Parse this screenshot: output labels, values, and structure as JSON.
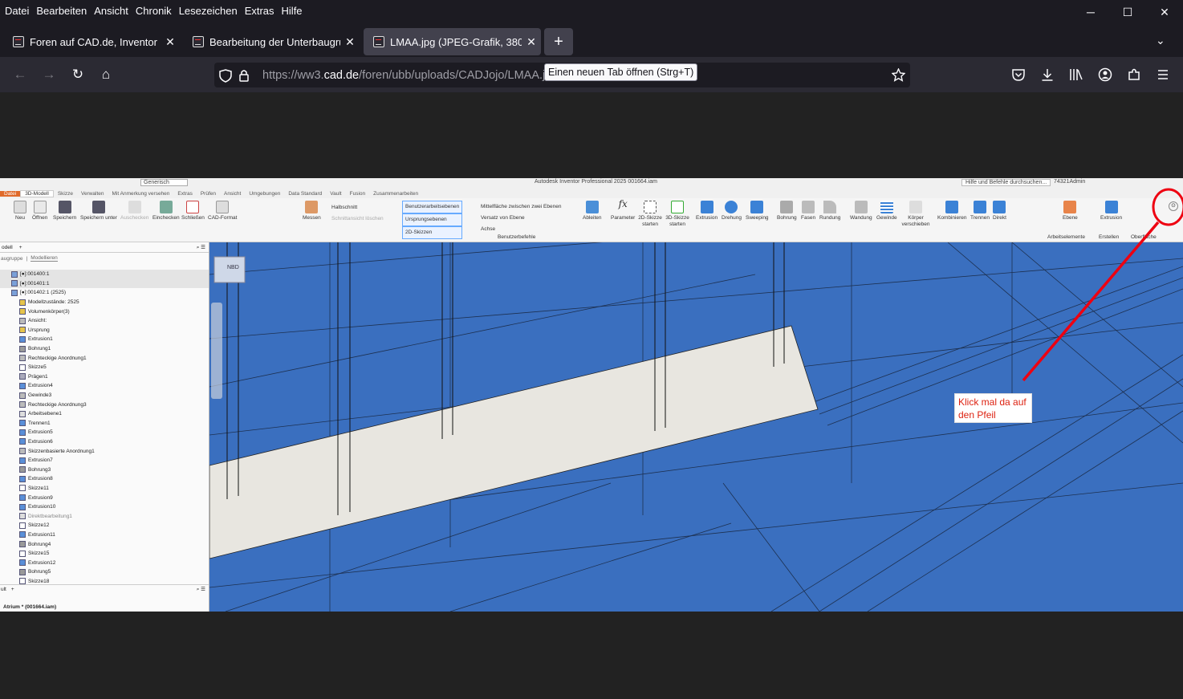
{
  "menu": [
    "Datei",
    "Bearbeiten",
    "Ansicht",
    "Chronik",
    "Lesezeichen",
    "Extras",
    "Hilfe"
  ],
  "window_controls": {
    "minimize": "─",
    "maximize": "☐",
    "close": "✕"
  },
  "tabs": [
    {
      "title": "Foren auf CAD.de, Inventor",
      "close": "✕"
    },
    {
      "title": "Bearbeitung der Unterbaugrupp",
      "close": "✕"
    },
    {
      "title": "LMAA.jpg (JPEG-Grafik, 3806",
      "close": "✕"
    }
  ],
  "new_tab_symbol": "+",
  "tab_list_symbol": "⌄",
  "nav": {
    "back": "←",
    "forward": "→",
    "reload": "↻",
    "home": "⌂"
  },
  "url": {
    "prefix": "https://ww3.",
    "domain": "cad.de",
    "path": "/foren/ubb/uploads/CADJojo/LMAA.jpg"
  },
  "tooltip": "Einen neuen Tab öffnen (Strg+T)",
  "inventor": {
    "title": "Autodesk Inventor Professional 2025    001664.iam",
    "search_hint": "Hilfe und Befehle durchsuchen...",
    "user": "74321Admin",
    "style_select": "Generisch",
    "ribbon_tabs": [
      "Datei",
      "3D-Modell",
      "Skizze",
      "Verwalten",
      "Mit Anmerkung versehen",
      "Extras",
      "Prüfen",
      "Ansicht",
      "Umgebungen",
      "Data Standard",
      "Vault",
      "Fusion",
      "Zusammenarbeiten"
    ],
    "ribbon_buttons": [
      "Neu",
      "Öffnen",
      "Speichern",
      "Speichern unter",
      "Auschecken",
      "Einchecken",
      "Schließen",
      "CAD-Format",
      "Messen",
      "Ableiten",
      "Parameter",
      "2D-Skizze starten",
      "3D-Skizze starten",
      "Extrusion",
      "Drehung",
      "Sweeping",
      "Bohrung",
      "Fasen",
      "Rundung",
      "Wandung",
      "Gewinde",
      "Körper verschieben",
      "Kombinieren",
      "Trennen",
      "Direkt",
      "Ebene",
      "Extrusion"
    ],
    "ribbon_small": [
      "Halbschnitt",
      "Schnittansicht löschen",
      "Benutzerarbeitsebenen",
      "Ursprungsebenen",
      "2D-Skizzen",
      "Mittelfläche zwischen zwei Ebenen",
      "Versatz von Ebene",
      "Achse"
    ],
    "ribbon_groups": [
      "Benutzerbefehle",
      "Arbeitselemente",
      "Erstellen",
      "Oberfläche"
    ],
    "browser_tabs": [
      "odell",
      "+"
    ],
    "browser_subtabs": [
      "augruppe",
      "Modellieren"
    ],
    "tree": [
      "[●]:001400:1",
      "[●]:001401:1",
      "[●]:001402:1 (2525)",
      "Modellzustände: 2525",
      "Volumenkörper(3)",
      "Ansicht:",
      "Ursprung",
      "Extrusion1",
      "Bohrung1",
      "Rechteckige Anordnung1",
      "Skizze5",
      "Prägen1",
      "Extrusion4",
      "Gewinde3",
      "Rechteckige Anordnung3",
      "Arbeitsebene1",
      "Trennen1",
      "Extrusion5",
      "Extrusion6",
      "Skizzenbasierte Anordnung1",
      "Extrusion7",
      "Bohrung3",
      "Extrusion8",
      "Skizze11",
      "Extrusion9",
      "Extrusion10",
      "Direktbearbeitung1",
      "Skizze12",
      "Extrusion11",
      "Bohrung4",
      "Skizze15",
      "Extrusion12",
      "Bohrung5",
      "Skizze18"
    ],
    "bottom_tab": "ult",
    "bottom_item": "Atrium * (001664.iam)",
    "viewcube": "NBD"
  },
  "annotation": "Klick mal da auf den Pfeil"
}
